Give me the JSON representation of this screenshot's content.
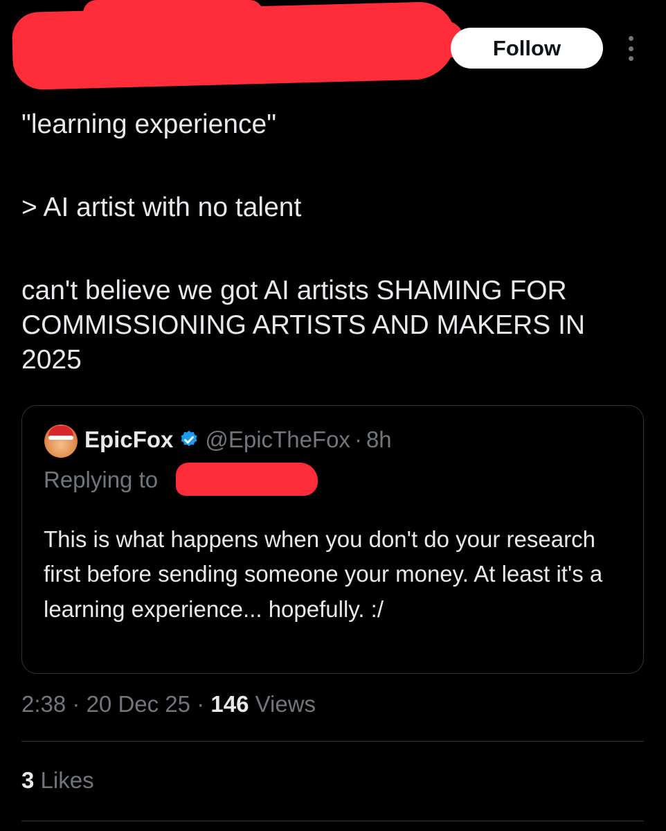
{
  "header": {
    "follow_label": "Follow",
    "more_icon": "more-vertical-icon",
    "redaction_color": "#ff2d3a"
  },
  "tweet": {
    "text_line1": "\"learning experience\"",
    "text_line2": "> AI artist with no talent",
    "text_line3": "can't believe we got AI artists SHAMING FOR COMMISSIONING ARTISTS AND MAKERS IN 2025"
  },
  "quote": {
    "avatar_icon": "fox-avatar-icon",
    "name": "EpicFox",
    "verified_icon": "verified-badge-icon",
    "handle": "@EpicTheFox",
    "separator": "·",
    "time": "8h",
    "replying_to": "Replying to",
    "body": "This is what happens when you don't do your research first before sending someone your money. At least it's a learning experience... hopefully.  :/"
  },
  "meta": {
    "time": "2:38",
    "separator": "·",
    "date": "20 Dec 25",
    "views_count": "146",
    "views_label": "Views"
  },
  "stats": {
    "likes_count": "3",
    "likes_label": "Likes"
  },
  "colors": {
    "background": "#000000",
    "text_primary": "#e7e9ea",
    "text_secondary": "#71767b",
    "border": "#2f3336",
    "verified": "#1d9bf0"
  }
}
